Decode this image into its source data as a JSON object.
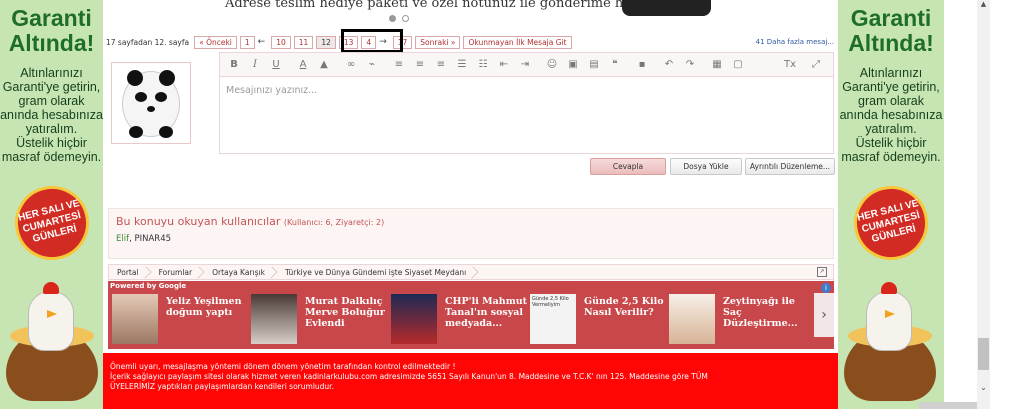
{
  "side_ad": {
    "title_line1": "Garanti",
    "title_line2": "Altında!",
    "text": [
      "Altınlarınızı",
      "Garanti'ye getirin,",
      "gram olarak",
      "anında hesabınıza",
      "yatıralım.",
      "Üstelik hiçbir",
      "masraf ödemeyin."
    ],
    "badge": "HER SALI VE CUMARTESİ GÜNLERİ",
    "accent": "#1f6d2a",
    "background": "#c7e5b3"
  },
  "top_ad": {
    "text": "Adrese teslim hediye paketi ve özel notunuz ile gönderime hazır"
  },
  "pager": {
    "label": "17 sayfadan 12. sayfa",
    "prev": "« Önceki",
    "pages": [
      "1",
      "10",
      "11",
      "12",
      "13"
    ],
    "current": "12",
    "arrow_left": "←",
    "page_16": "4",
    "arrow_right": "→",
    "last": "17",
    "next": "Sonraki »",
    "unread": "Okunmayan İlk Mesaja Git",
    "right_text": "41 Daha fazla mesaj..."
  },
  "editor": {
    "placeholder": "Mesajınızı yazınız...",
    "toolbar": {
      "bold": "B",
      "italic": "I",
      "underline": "U",
      "font_color": "A",
      "clear_format": "Tx"
    }
  },
  "buttons": {
    "reply": "Cevapla",
    "upload": "Dosya Yükle",
    "advanced": "Ayrıntılı Düzenleme..."
  },
  "readers": {
    "title": "Bu konuyu okuyan kullanıcılar",
    "counts": "(Kullanıcı: 6, Ziyaretçi: 2)",
    "user1": "Elif",
    "user2": ", PINAR45"
  },
  "breadcrumb": [
    "Portal",
    "Forumlar",
    "Ortaya Karışık",
    "Türkiye ve Dünya Gündemi işte Siyaset Meydanı"
  ],
  "news": {
    "powered_prefix": "Powered by",
    "powered_brand": "Google",
    "items": [
      {
        "title": "Yeliz Yeşilmen doğum yaptı"
      },
      {
        "title": "Murat Dalkılıç Merve Boluğur Evlendi"
      },
      {
        "title": "CHP'li Mahmut Tanal'ın sosyal medyada..."
      },
      {
        "title": "Günde 2,5 Kilo Nasıl Verilir?"
      },
      {
        "title": "Zeytinyağı ile Saç Düzleştirme..."
      }
    ],
    "thumb3_text": "Günde 2,5 Kilo Vermeliyim",
    "next": "›",
    "info": "i"
  },
  "warning": {
    "line1": "Önemli uyarı, mesajlaşma yöntemi dönem dönem yönetim tarafından kontrol edilmektedir !",
    "line2": "İçerik sağlayıcı paylaşım sitesi olarak hizmet veren kadinlarkulubu.com adresimizde 5651 Sayılı Kanun'un 8. Maddesine ve T.C.K' nın 125. Maddesine göre TÜM",
    "line3": "ÜYELERİMİZ yaptıkları paylaşımlardan kendileri sorumludur."
  }
}
